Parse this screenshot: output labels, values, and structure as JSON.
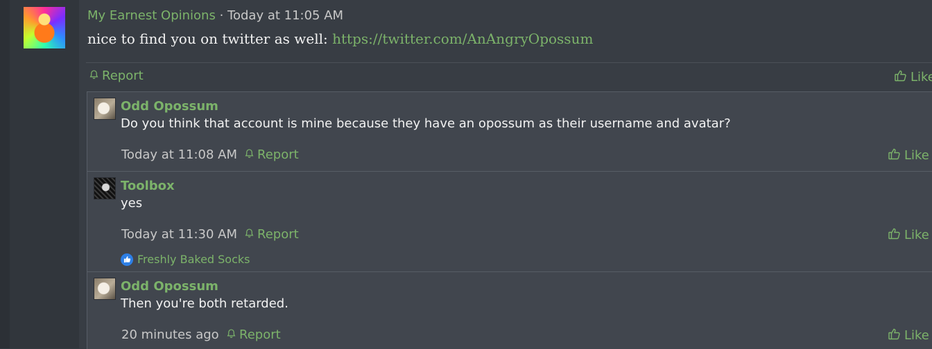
{
  "colors": {
    "accent": "#7cb36a",
    "background": "#383d44",
    "reply_background": "#41464e",
    "reaction_blue": "#2d7fe6"
  },
  "post": {
    "author": "My Earnest Opinions",
    "separator": "·",
    "timestamp": "Today at 11:05 AM",
    "body_text": "nice to find you on twitter as well: ",
    "link_text": "https://twitter.com/AnAngryOpossum",
    "report_label": "Report",
    "like_label": "Like"
  },
  "replies": [
    {
      "author": "Odd Opossum",
      "text": "Do you think that account is mine because they have an opossum as their username and avatar?",
      "timestamp": "Today at 11:08 AM",
      "report_label": "Report",
      "like_label": "Like"
    },
    {
      "author": "Toolbox",
      "text": "yes",
      "timestamp": "Today at 11:30 AM",
      "report_label": "Report",
      "like_label": "Like",
      "reaction_user": "Freshly Baked Socks"
    },
    {
      "author": "Odd Opossum",
      "text": "Then you're both retarded.",
      "timestamp": "20 minutes ago",
      "report_label": "Report",
      "like_label": "Like"
    }
  ]
}
